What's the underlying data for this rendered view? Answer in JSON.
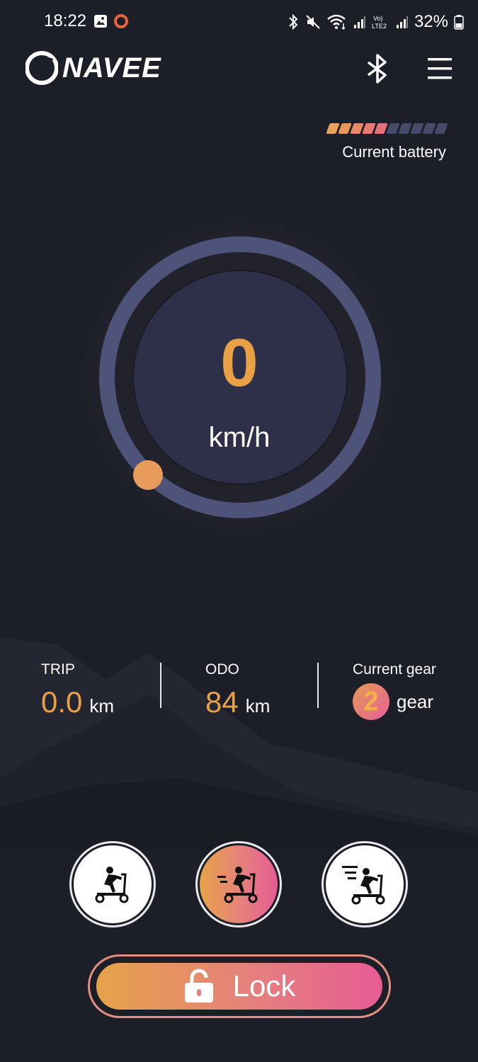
{
  "status_bar": {
    "time": "18:22",
    "battery_percent": "32%",
    "icons": [
      "image-icon",
      "record-icon",
      "bluetooth-icon",
      "mute-icon",
      "wifi-icon",
      "signal-icon",
      "volte-icon",
      "signal-icon",
      "battery-icon"
    ]
  },
  "header": {
    "brand": "NAVEE",
    "icons": [
      "bluetooth-icon",
      "menu-icon"
    ]
  },
  "battery": {
    "label": "Current battery",
    "segments_total": 10,
    "segments_filled": 5
  },
  "speedometer": {
    "speed": "0",
    "unit": "km/h"
  },
  "stats": {
    "trip": {
      "label": "TRIP",
      "value": "0.0",
      "unit": "km"
    },
    "odo": {
      "label": "ODO",
      "value": "84",
      "unit": "km"
    },
    "gear": {
      "label": "Current gear",
      "value": "2",
      "unit": "gear"
    }
  },
  "modes": [
    {
      "name": "walk-mode",
      "active": false
    },
    {
      "name": "standard-mode",
      "active": true
    },
    {
      "name": "sport-mode",
      "active": false
    }
  ],
  "lock_button": {
    "label": "Lock"
  },
  "colors": {
    "background": "#1c1f28",
    "accent_orange": "#eaa045",
    "accent_pink": "#e65c93",
    "ring": "#4e5479",
    "dial_inner": "#2e2f48"
  }
}
